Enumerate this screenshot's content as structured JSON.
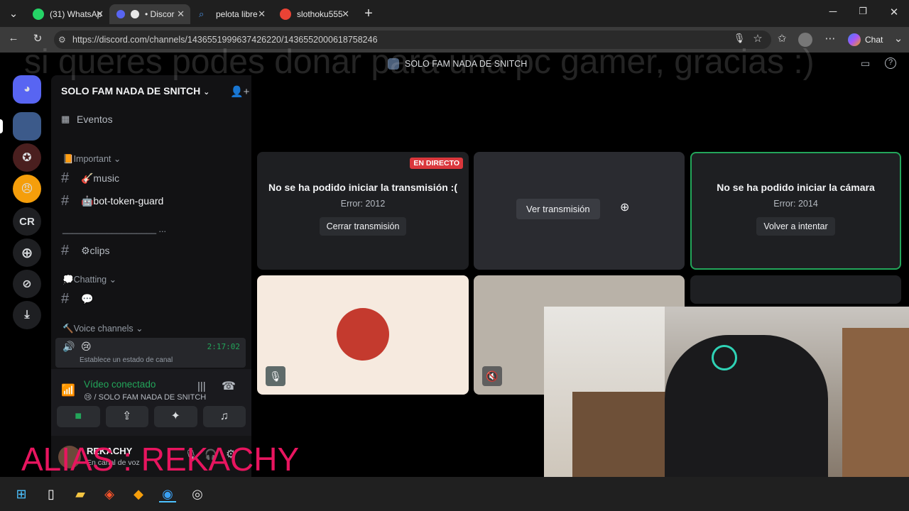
{
  "browser": {
    "tabs": [
      {
        "label": "(31) WhatsAp",
        "icon": "whatsapp-icon",
        "color": "#25d366"
      },
      {
        "label": "• Discor",
        "icon": "discord-tab-icon",
        "color": "#5865f2"
      },
      {
        "label": "pelota libre",
        "icon": "search-icon",
        "color": "#4a90e2"
      },
      {
        "label": "slothoku555",
        "icon": "google-icon",
        "color": "#ea4335"
      }
    ],
    "new_tab": "+",
    "url": "https://discord.com/channels/1436551999637426220/1436552000618758246",
    "chat_label": "Chat"
  },
  "overlay": {
    "donate_text": "si queres podes donar para una pc gamer, gracias :)",
    "alias_text": "ALIAS : REKACHY"
  },
  "discord": {
    "title": "SOLO FAM NADA DE SNITCH",
    "server_name": "SOLO FAM NADA DE SNITCH",
    "rail": [
      {
        "label": "",
        "icon": "discord-home-icon"
      },
      {
        "label": "CR",
        "icon": ""
      }
    ],
    "events_label": "Eventos",
    "category_important": "📙Important",
    "channels": [
      {
        "name": "🎸music"
      },
      {
        "name": "🤖bot-token-guard"
      },
      {
        "name": "⚙clips"
      },
      {
        "name": "💬"
      }
    ],
    "divider_text": "___________________ ...",
    "category_chatting": "💭Chatting",
    "category_voice": "🔨Voice channels",
    "voice_channel": {
      "emoji": "😢",
      "timer": "2:17:02",
      "status": "Establece un estado de canal"
    },
    "voice_status": {
      "title": "Vídeo conectado",
      "subtitle": "😢 / SOLO FAM NADA DE SNITCH"
    },
    "user": {
      "name": "REKACHY",
      "status": "En canal de voz"
    },
    "tiles": {
      "t1": {
        "badge": "EN DIRECTO",
        "title": "No se ha podido iniciar la transmisión :(",
        "error": "Error: 2012",
        "button": "Cerrar transmisión"
      },
      "t2": {
        "button": "Ver transmisión"
      },
      "t3": {
        "title": "No se ha podido iniciar la cámara",
        "error": "Error: 2014",
        "button": "Volver a intentar"
      }
    },
    "colors": {
      "accent_green": "#23a55a",
      "live_red": "#da373c"
    }
  }
}
